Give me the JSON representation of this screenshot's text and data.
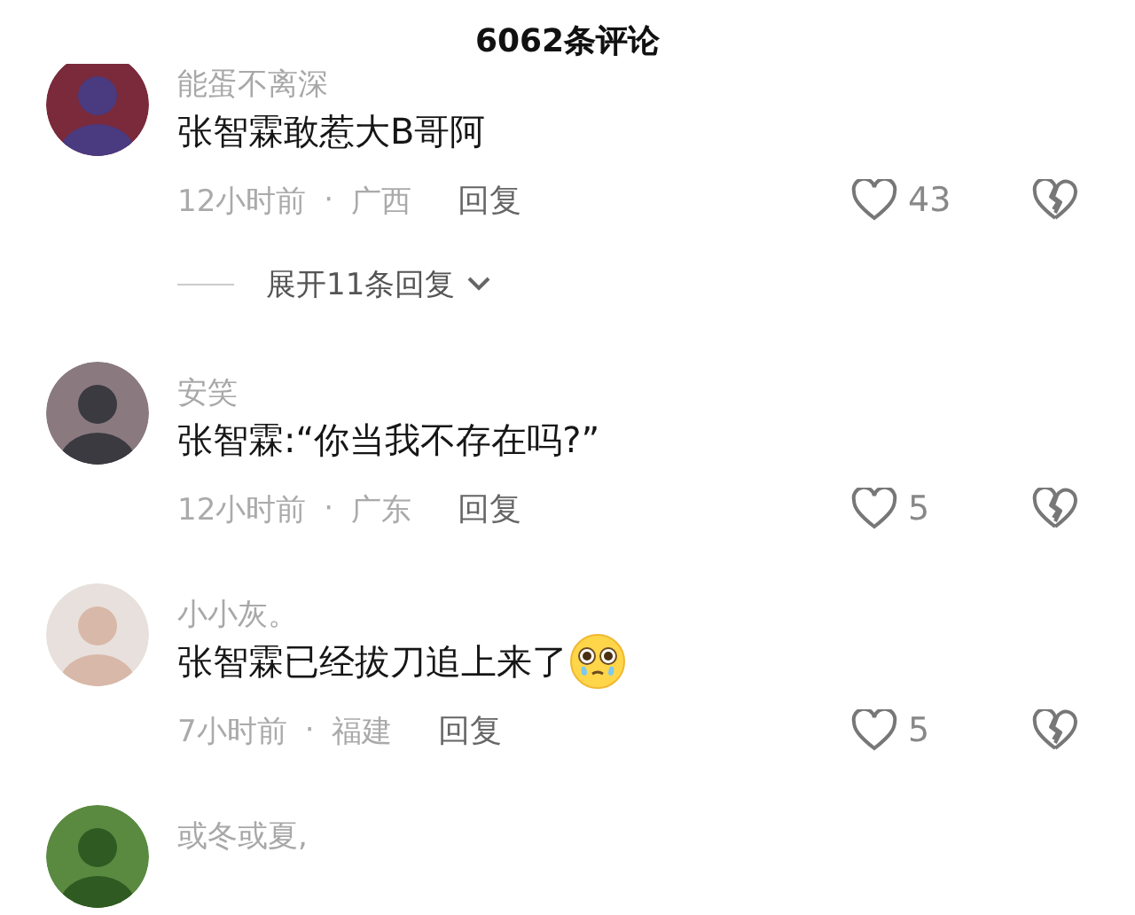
{
  "title": "6062条评论",
  "comments": [
    {
      "username": "能蛋不离深",
      "text": "张智霖敢惹大B哥阿",
      "has_emoji": false,
      "time": "12小时前",
      "separator": "·",
      "location": "广西",
      "reply_label": "回复",
      "likes": "43",
      "expand_replies": "展开11条回复"
    },
    {
      "username": "安笑",
      "text": "张智霖:“你当我不存在吗?”",
      "has_emoji": false,
      "time": "12小时前",
      "separator": "·",
      "location": "广东",
      "reply_label": "回复",
      "likes": "5"
    },
    {
      "username": "小小灰。",
      "text": "张智霖已经拔刀追上来了",
      "has_emoji": true,
      "time": "7小时前",
      "separator": "·",
      "location": "福建",
      "reply_label": "回复",
      "likes": "5"
    },
    {
      "username": "或冬或夏,"
    }
  ]
}
